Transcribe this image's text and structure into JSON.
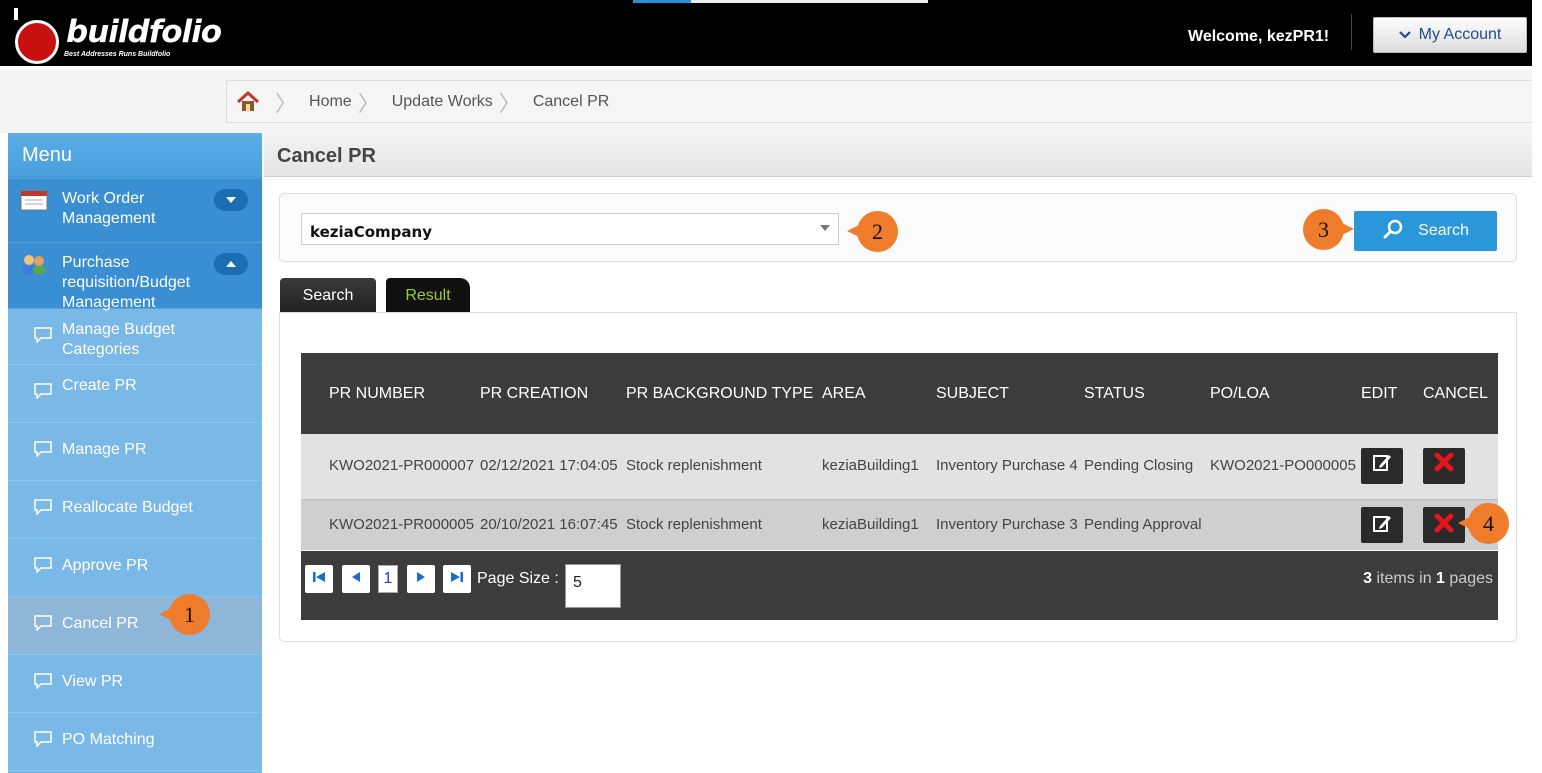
{
  "header": {
    "brand": "buildfolio",
    "tagline": "Best Addresses Runs Buildfolio",
    "welcome": "Welcome, kezPR1!",
    "account_label": "My Account"
  },
  "breadcrumb": [
    "Home",
    "Update Works",
    "Cancel PR"
  ],
  "sidebar": {
    "title": "Menu",
    "groups": [
      {
        "label": "Work Order Management"
      },
      {
        "label": "Purchase requisition/Budget Management"
      }
    ],
    "items": [
      {
        "label": "Manage Budget Categories"
      },
      {
        "label": "Create PR"
      },
      {
        "label": "Manage PR"
      },
      {
        "label": "Reallocate Budget"
      },
      {
        "label": "Approve PR"
      },
      {
        "label": "Cancel PR"
      },
      {
        "label": "View PR"
      },
      {
        "label": "PO Matching"
      }
    ]
  },
  "page": {
    "title": "Cancel PR",
    "company_select": "keziaCompany",
    "search_button": "Search",
    "tabs": [
      "Search",
      "Result"
    ]
  },
  "table": {
    "headers": [
      "PR NUMBER",
      "PR CREATION",
      "PR BACKGROUND TYPE",
      "AREA",
      "SUBJECT",
      "STATUS",
      "PO/LOA",
      "EDIT",
      "CANCEL"
    ],
    "rows": [
      {
        "pr_number": "KWO2021-PR000007",
        "pr_creation": "02/12/2021 17:04:05",
        "background_type": "Stock replenishment",
        "area": "keziaBuilding1",
        "subject": "Inventory Purchase 4",
        "status": "Pending Closing",
        "po_loa": "KWO2021-PO000005"
      },
      {
        "pr_number": "KWO2021-PR000005",
        "pr_creation": "20/10/2021 16:07:45",
        "background_type": "Stock replenishment",
        "area": "keziaBuilding1",
        "subject": "Inventory Purchase 3",
        "status": "Pending Approval",
        "po_loa": ""
      }
    ]
  },
  "pager": {
    "current_page": "1",
    "page_size_label": "Page Size :",
    "page_size": "5",
    "items_count": "3",
    "items_text": "items in",
    "pages_count": "1",
    "pages_text": "pages"
  },
  "callouts": [
    "1",
    "2",
    "3",
    "4"
  ],
  "colors": {
    "header_bg": "#000000",
    "sidebar_bg": "#7ab8e8",
    "accent_blue": "#2a97db",
    "callout": "#ef7c2a",
    "table_head": "#3c3c3c"
  }
}
